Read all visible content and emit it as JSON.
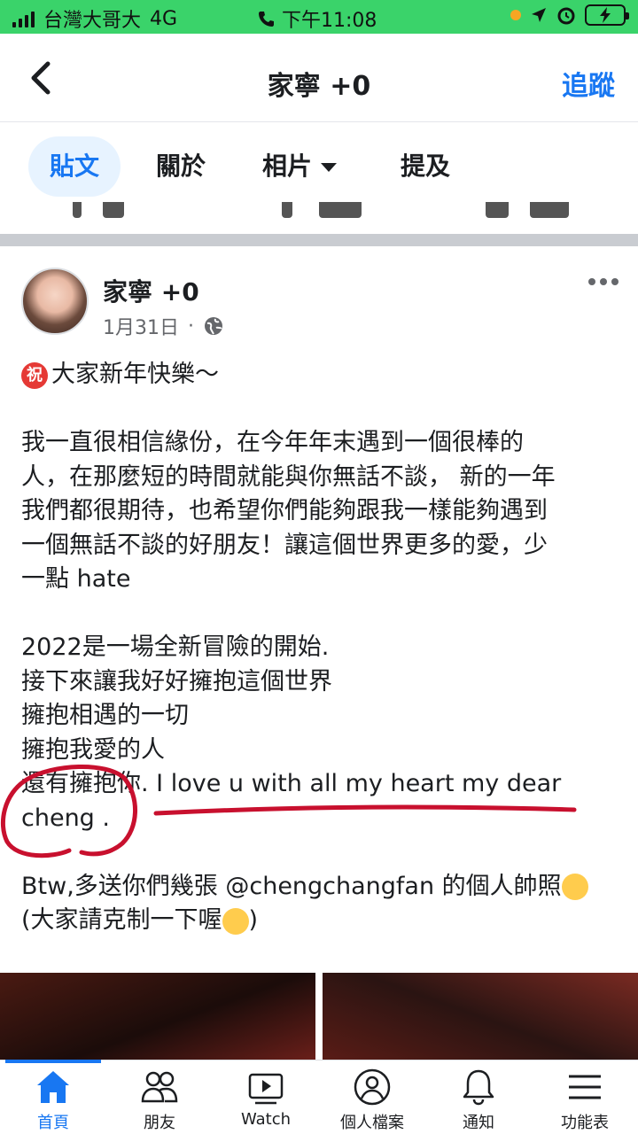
{
  "status_bar": {
    "carrier": "台灣大哥大",
    "network": "4G",
    "time": "下午11:08"
  },
  "header": {
    "title": "家寧 +0",
    "follow_label": "追蹤"
  },
  "tabs": [
    {
      "label": "貼文",
      "active": true
    },
    {
      "label": "關於",
      "active": false
    },
    {
      "label": "相片",
      "active": false
    },
    {
      "label": "提及",
      "active": false
    }
  ],
  "post": {
    "author": "家寧 +0",
    "date": "1月31日",
    "separator": "·",
    "lines": [
      "大家新年快樂～",
      "",
      "我一直很相信緣份，在今年年末遇到一個很棒的",
      "人，在那麼短的時間就能與你無話不談， 新的一年",
      "我們都很期待，也希望你們能夠跟我一樣能夠遇到",
      "一個無話不談的好朋友！讓這個世界更多的愛，少",
      "一點 hate",
      "",
      "2022是一場全新冒險的開始.",
      "接下來讓我好好擁抱這個世界",
      "擁抱相遇的一切",
      "擁抱我愛的人",
      "還有擁抱你. I love u with all my heart my dear",
      "cheng .",
      "",
      "Btw,多送你們幾張  @chengchangfan 的個人帥照",
      "(大家請克制一下喔"
    ],
    "blessing_badge": "祝",
    "closing_paren": ")"
  },
  "bottom_nav": [
    {
      "label": "首頁",
      "icon": "home-icon",
      "active": true
    },
    {
      "label": "朋友",
      "icon": "friends-icon",
      "active": false
    },
    {
      "label": "Watch",
      "icon": "watch-icon",
      "active": false
    },
    {
      "label": "個人檔案",
      "icon": "profile-icon",
      "active": false
    },
    {
      "label": "通知",
      "icon": "bell-icon",
      "active": false
    },
    {
      "label": "功能表",
      "icon": "menu-icon",
      "active": false
    }
  ],
  "colors": {
    "status_bar": "#3ad36a",
    "accent": "#1877f2",
    "annotation": "#c8102e"
  }
}
